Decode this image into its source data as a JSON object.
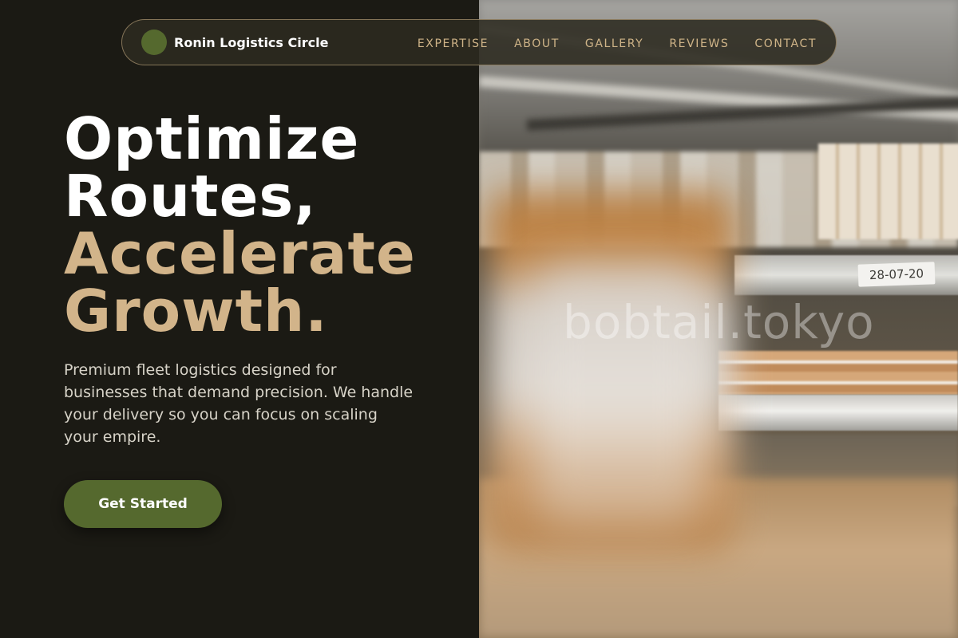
{
  "brand": {
    "name": "Ronin Logistics Circle"
  },
  "nav": {
    "items": [
      {
        "label": "EXPERTISE"
      },
      {
        "label": "ABOUT"
      },
      {
        "label": "GALLERY"
      },
      {
        "label": "REVIEWS"
      },
      {
        "label": "CONTACT"
      }
    ]
  },
  "hero": {
    "title_lines": [
      "Optimize",
      "Routes,",
      "Accelerate",
      "Growth."
    ],
    "description": "Premium fleet logistics designed for businesses that demand precision. We handle your delivery so you can focus on scaling your empire.",
    "cta_label": "Get Started"
  },
  "photo": {
    "shelf_label": "28-07-20",
    "watermark": "bobtail.tokyo"
  },
  "colors": {
    "background": "#1b1a14",
    "accent_tan": "#d2b48a",
    "nav_text": "#cfb488",
    "olive": "#55692e",
    "white": "#ffffff"
  }
}
